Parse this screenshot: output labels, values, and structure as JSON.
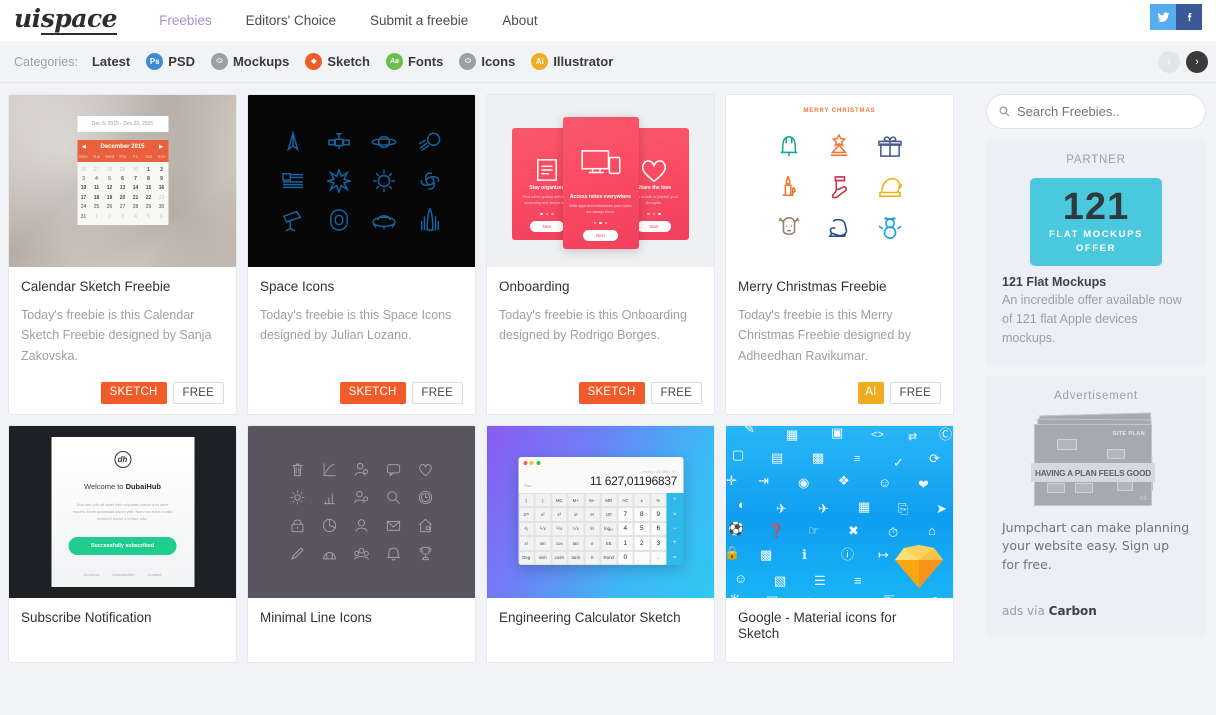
{
  "header": {
    "logo": "uispace",
    "nav": [
      {
        "label": "Freebies",
        "active": true
      },
      {
        "label": "Editors' Choice",
        "active": false
      },
      {
        "label": "Submit a freebie",
        "active": false
      },
      {
        "label": "About",
        "active": false
      }
    ],
    "social": [
      {
        "name": "twitter",
        "color": "#55acee"
      },
      {
        "name": "facebook",
        "color": "#3b5998"
      }
    ]
  },
  "categories": {
    "label": "Categories:",
    "items": [
      {
        "label": "Latest",
        "icon": null,
        "icon_color": null,
        "icon_text": null
      },
      {
        "label": "PSD",
        "icon": "psd-icon",
        "icon_color": "#3d8bd4",
        "icon_text": "Ps"
      },
      {
        "label": "Mockups",
        "icon": "mockups-icon",
        "icon_color": "#9aa0a6",
        "icon_text": "⬭"
      },
      {
        "label": "Sketch",
        "icon": "sketch-icon",
        "icon_color": "#f15a29",
        "icon_text": "◆"
      },
      {
        "label": "Fonts",
        "icon": "fonts-icon",
        "icon_color": "#6abf4b",
        "icon_text": "Aa"
      },
      {
        "label": "Icons",
        "icon": "icons-icon",
        "icon_color": "#9aa0a6",
        "icon_text": "⬭"
      },
      {
        "label": "Illustrator",
        "icon": "illustrator-icon",
        "icon_color": "#f0ab20",
        "icon_text": "Ai"
      }
    ],
    "carousel": {
      "prev": "‹",
      "next": "›"
    }
  },
  "cards": [
    {
      "title": "Calendar Sketch Freebie",
      "description": "Today's freebie is this Calendar Sketch Freebie designed by Sanja Zakovska.",
      "tags": [
        {
          "label": "SKETCH",
          "type": "sketch"
        },
        {
          "label": "FREE",
          "type": "free"
        }
      ],
      "thumb": "calendar"
    },
    {
      "title": "Space Icons",
      "description": "Today's freebie is this Space Icons designed by Julian Lozano.",
      "tags": [
        {
          "label": "SKETCH",
          "type": "sketch"
        },
        {
          "label": "FREE",
          "type": "free"
        }
      ],
      "thumb": "space"
    },
    {
      "title": "Onboarding",
      "description": "Today's freebie is this Onboarding designed by Rodrigo Borges.",
      "tags": [
        {
          "label": "SKETCH",
          "type": "sketch"
        },
        {
          "label": "FREE",
          "type": "free"
        }
      ],
      "thumb": "onboarding"
    },
    {
      "title": "Merry Christmas Freebie",
      "description": "Today's freebie is this Merry Christmas Freebie designed by Adheedhan Ravikumar.",
      "tags": [
        {
          "label": "AI",
          "type": "ai"
        },
        {
          "label": "FREE",
          "type": "free"
        }
      ],
      "thumb": "xmas"
    },
    {
      "title": "Subscribe Notification",
      "description": "",
      "tags": [],
      "thumb": "subscribe"
    },
    {
      "title": "Minimal Line Icons",
      "description": "",
      "tags": [],
      "thumb": "minimal"
    },
    {
      "title": "Engineering Calculator Sketch",
      "description": "",
      "tags": [],
      "thumb": "calculator"
    },
    {
      "title": "Google - Material icons for Sketch",
      "description": "",
      "tags": [],
      "thumb": "google"
    }
  ],
  "thumb_calendar": {
    "range": "Dec 6, 2015 - Dec 22, 2015",
    "month": "December 2015",
    "daynames": [
      "Mon",
      "Tue",
      "Wed",
      "Thu",
      "Fri",
      "Sat",
      "Sun"
    ],
    "weeks": [
      [
        "26",
        "27",
        "28",
        "29",
        "30",
        "1",
        "2"
      ],
      [
        "3",
        "4",
        "5",
        "6",
        "7",
        "8",
        "9"
      ],
      [
        "10",
        "11",
        "12",
        "13",
        "14",
        "15",
        "16"
      ],
      [
        "17",
        "18",
        "19",
        "20",
        "21",
        "22",
        "23"
      ],
      [
        "24",
        "25",
        "26",
        "27",
        "28",
        "29",
        "30"
      ],
      [
        "31",
        "1",
        "2",
        "3",
        "4",
        "5",
        "6"
      ]
    ]
  },
  "thumb_onboarding": {
    "screens": [
      {
        "heading": "Stay organized",
        "body": "Find notes quickly with faster searching and simple tags.",
        "button": "Next"
      },
      {
        "heading": "Access notes everywhere",
        "body": "With apps and extensions your notes are always there.",
        "button": "Next"
      },
      {
        "heading": "Share the love",
        "body": "Share a note or publish your thoughts.",
        "button": "Start"
      }
    ]
  },
  "thumb_xmas": {
    "title": "MERRY CHRISTMAS"
  },
  "thumb_subscribe": {
    "logo": "dh",
    "heading_prefix": "Welcome to ",
    "heading_brand": "DubaiHub",
    "body": "Duis sed odio sit amet nibh vulputate cursus a sit amet mauris. Morbi accumsan ipsum velit. Nam nec tellus a odio tincidunt auctor a ornare odio.",
    "button": "Successfully subscribed",
    "links": [
      "About us",
      "Unsubscribe",
      "Contact"
    ]
  },
  "thumb_calculator": {
    "label": "Rad",
    "display": "11 627,01196837",
    "history": "sin(30) × (23 256 − 2) ÷",
    "rows": [
      [
        "(",
        ")",
        "MC",
        "M+",
        "M−",
        "MR",
        "AC",
        "±",
        "%",
        "÷"
      ],
      [
        "2ⁿʸ",
        "x²",
        "x³",
        "xʸ",
        "eʸ",
        "10ʸ",
        "7",
        "8",
        "9",
        "×"
      ],
      [
        "¹⁄ₓ",
        "²√x",
        "³√x",
        "ʸ√x",
        "ln",
        "log₁₀",
        "4",
        "5",
        "6",
        "−"
      ],
      [
        "x!",
        "sin",
        "cos",
        "tan",
        "e",
        "EE",
        "1",
        "2",
        "3",
        "+"
      ],
      [
        "Deg",
        "sinh",
        "cosh",
        "tanh",
        "π",
        "Rand",
        "0",
        "",
        ".",
        "="
      ]
    ]
  },
  "sidebar": {
    "search": {
      "placeholder": "Search Freebies.."
    },
    "partner": {
      "label": "PARTNER",
      "badge_number": "121",
      "badge_line1": "FLAT MOCKUPS",
      "badge_line2": "OFFER",
      "title": "121 Flat Mockups",
      "description": "An incredible offer available now of 121 flat Apple devices mockups.",
      "color": "#4ac8de"
    },
    "advertisement": {
      "label": "Advertisement",
      "image_band_text": "HAVING A PLAN FEELS GOOD",
      "image_label_1": "SITE PLAN",
      "image_label_2": "V3",
      "text": "Jumpchart can make planning your website easy. Sign up for free.",
      "via_prefix": "ads via ",
      "via_brand": "Carbon"
    }
  }
}
